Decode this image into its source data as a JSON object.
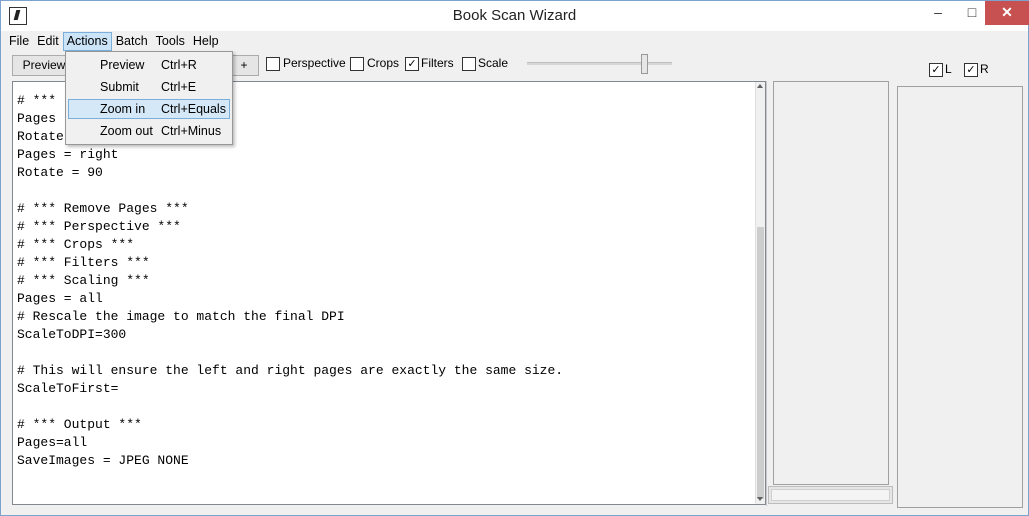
{
  "window": {
    "title": "Book Scan Wizard"
  },
  "menubar": [
    "File",
    "Edit",
    "Actions",
    "Batch",
    "Tools",
    "Help"
  ],
  "actions_menu": [
    {
      "label": "Preview",
      "shortcut": "Ctrl+R"
    },
    {
      "label": "Submit",
      "shortcut": "Ctrl+E"
    },
    {
      "label": "Zoom in",
      "shortcut": "Ctrl+Equals"
    },
    {
      "label": "Zoom out",
      "shortcut": "Ctrl+Minus"
    }
  ],
  "toolbar": {
    "preview_label": "Preview",
    "plus_label": "+",
    "checks": [
      {
        "label": "Perspective",
        "checked": false
      },
      {
        "label": "Crops",
        "checked": false
      },
      {
        "label": "Filters",
        "checked": true
      },
      {
        "label": "Scale",
        "checked": false
      }
    ],
    "right_checks": [
      {
        "label": "L",
        "checked": true
      },
      {
        "label": "R",
        "checked": true
      }
    ]
  },
  "editor": {
    "lines": [
      "# ***",
      "Pages",
      "Rotate",
      "Pages = right",
      "Rotate = 90",
      "",
      "# *** Remove Pages ***",
      "# *** Perspective ***",
      "# *** Crops ***",
      "# *** Filters ***",
      "# *** Scaling ***",
      "Pages = all",
      "# Rescale the image to match the final DPI",
      "ScaleToDPI=300",
      "",
      "# This will ensure the left and right pages are exactly the same size.",
      "ScaleToFirst=",
      "",
      "# *** Output ***",
      "Pages=all",
      "SaveImages = JPEG NONE"
    ]
  },
  "icons": {
    "check": "✓",
    "minimize": "–",
    "maximize": "□",
    "close": "✕"
  }
}
